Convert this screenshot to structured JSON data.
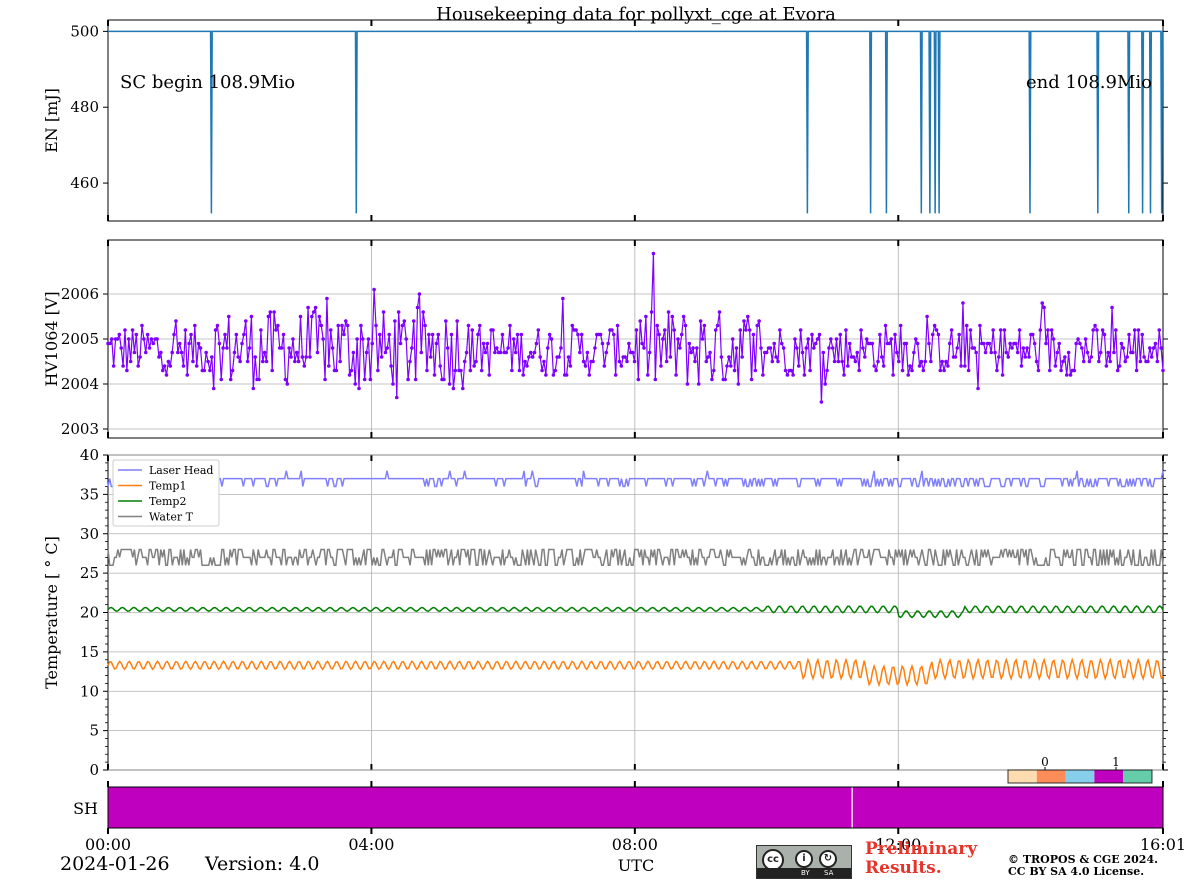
{
  "title": "Housekeeping data for pollyxt_cge at Evora",
  "footer": {
    "date": "2024-01-26",
    "version": "Version: 4.0",
    "xlabel": "UTC",
    "preliminary_line1": "Preliminary",
    "preliminary_line2": "Results.",
    "copyright_line1": "© TROPOS & CGE 2024.",
    "copyright_line2": "CC BY SA 4.0 License.",
    "cc_badge_labels": [
      "BY",
      "SA"
    ]
  },
  "x_ticks": [
    "00:00",
    "04:00",
    "08:00",
    "12:00",
    "16:01"
  ],
  "colors": {
    "energy": "#1f77b4",
    "hv1064": "#7f00ff",
    "laser_head": "#7f7fff",
    "temp1": "#ff7f0e",
    "temp2": "#008000",
    "water_t": "#808080",
    "shutter": "#bf00bf"
  },
  "chart_data": [
    {
      "type": "line",
      "id": "energy",
      "ylabel": "EN [mJ]",
      "ylim": [
        450,
        503
      ],
      "yticks": [
        460,
        480,
        500
      ],
      "xlim_hours": [
        0,
        16.02
      ],
      "grid": false,
      "annotations": {
        "left": "SC begin 108.9Mio",
        "right": "end 108.9Mio"
      },
      "baseline": 500,
      "dropout_value": 452,
      "dropout_times_hours": [
        1.57,
        3.77,
        10.62,
        11.58,
        11.82,
        12.35,
        12.48,
        12.56,
        12.62,
        14.0,
        15.03,
        15.5,
        15.71,
        15.83,
        16.0
      ]
    },
    {
      "type": "line",
      "id": "hv1064",
      "ylabel": "HV1064 [V]",
      "ylim": [
        2002.8,
        2007.2
      ],
      "yticks": [
        2003,
        2004,
        2005,
        2006
      ],
      "grid": true,
      "marker": "dot",
      "sample_count": 560,
      "level": 2004.7,
      "spread": 0.55
    },
    {
      "type": "line",
      "id": "temperature",
      "ylabel": "Temperature [$^\\circ C$]",
      "ylabel_display": "Temperature [ ° C]",
      "ylim": [
        0,
        40
      ],
      "yticks": [
        0,
        5,
        10,
        15,
        20,
        25,
        30,
        35,
        40
      ],
      "grid": true,
      "legend": "top-left",
      "series": [
        {
          "name": "Laser Head",
          "level": 37,
          "low_level": 36
        },
        {
          "name": "Temp1",
          "level": 13.3,
          "amplitude": 0.5
        },
        {
          "name": "Temp2",
          "level": 20.4,
          "amplitude": 0.3
        },
        {
          "name": "Water T",
          "level": 27,
          "amplitude": 1.5
        }
      ]
    },
    {
      "type": "heatmap",
      "id": "shutter",
      "ylabel": "SH",
      "colorbar_ticks": [
        "0",
        "1"
      ],
      "colorbar_colors": [
        "#fddcb0",
        "#fc8d59",
        "#87ceeb",
        "#bf00bf",
        "#66cdaa"
      ],
      "gap_time_hours": 11.3
    }
  ]
}
